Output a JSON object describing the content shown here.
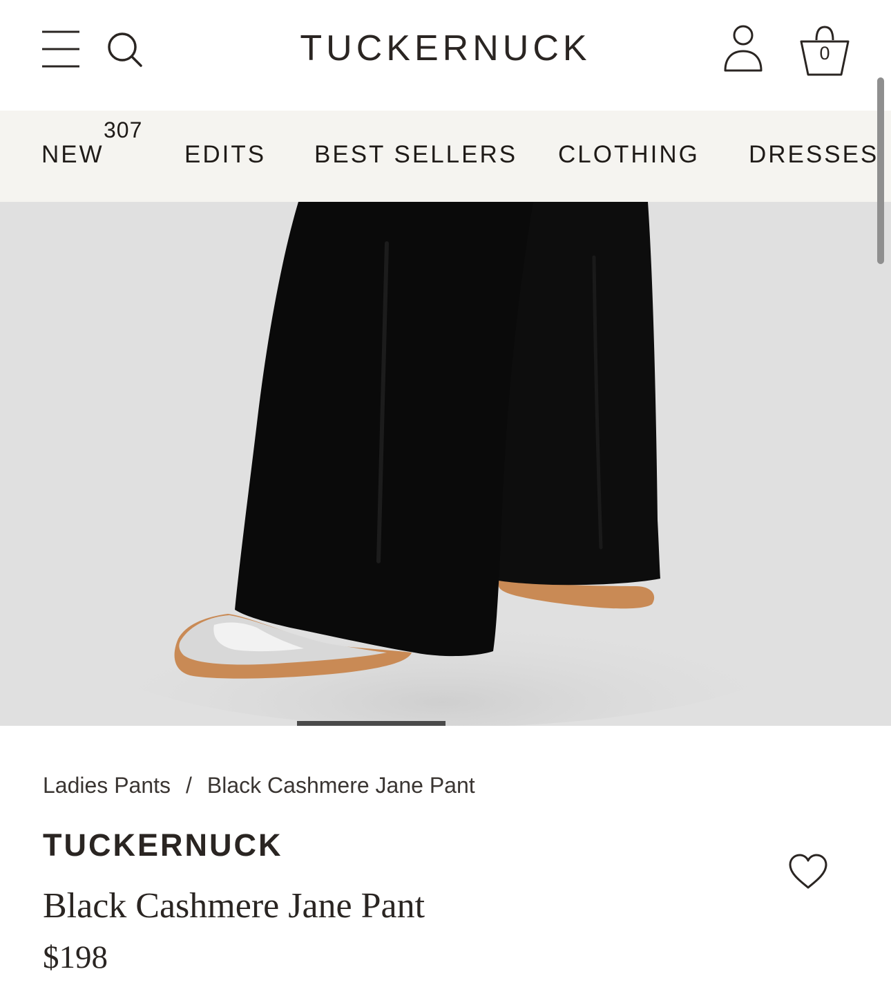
{
  "header": {
    "logo": "TUCKERNUCK",
    "bag_count": "0",
    "icons": [
      "hamburger-menu-icon",
      "search-icon",
      "account-icon",
      "shopping-bag-icon"
    ]
  },
  "nav": {
    "badge": "307",
    "items": [
      "NEW",
      "EDITS",
      "BEST SELLERS",
      "CLOTHING",
      "DRESSES"
    ]
  },
  "breadcrumb": {
    "category": "Ladies Pants",
    "separator": "/",
    "current": "Black Cashmere Jane Pant"
  },
  "product": {
    "brand": "TUCKERNUCK",
    "title": "Black Cashmere Jane Pant",
    "price": "$198"
  },
  "colors": {
    "text": "#2a2522",
    "nav_background": "#f5f4f0",
    "image_background": "#e0e0e0",
    "pant": "#0d0d0d",
    "sole": "#c98a55"
  }
}
